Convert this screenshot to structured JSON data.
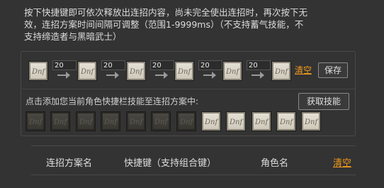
{
  "description": [
    "按下快捷键即可依次释放出连招内容，尚未完全使出连招时，再次按下无",
    "效，连招方案时间间隔可调整（范围1-9999ms）（不支持蓄气技能，不",
    "支持缔造者与黑暗武士）"
  ],
  "combo": {
    "intervals": [
      "20",
      "20",
      "20",
      "20",
      "20"
    ],
    "clear_label": "清空",
    "save_label": "保存"
  },
  "skillbar": {
    "hint": "点击添加您当前角色快捷栏技能至连招方案中:",
    "fetch_label": "获取技能"
  },
  "table": {
    "col_name": "连招方案名",
    "col_hotkey": "快捷键（支持组合键）",
    "col_role": "角色名",
    "clear_label": "清空"
  },
  "colors": {
    "accent": "#f09a1a",
    "background": "#333333"
  },
  "icons": {
    "skill": "dnf-skill-icon",
    "arrow": "arrow-right-icon"
  }
}
